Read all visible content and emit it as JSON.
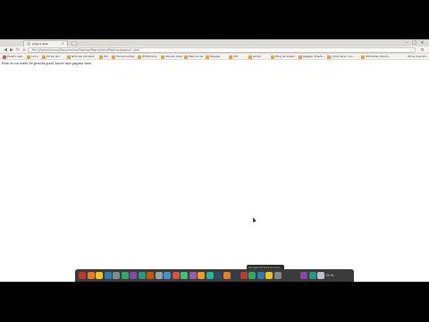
{
  "browser": {
    "tab_title": "página Web",
    "address": "file:///home/lenovo/Documentos/Paginas/Pagina/html/Paginas/pagina1.html"
  },
  "bookmarks": [
    {
      "label": "Diseño web",
      "color": "#d9534f"
    },
    {
      "label": "Linux",
      "color": "#e4a33a"
    },
    {
      "label": "Portal doc",
      "color": "#e4a33a"
    },
    {
      "label": "Noticias actuales",
      "color": "#e4a33a"
    },
    {
      "label": "W3",
      "color": "#e4a33a"
    },
    {
      "label": "Herramientas",
      "color": "#e4a33a"
    },
    {
      "label": "W3Schools",
      "color": "#e4a33a"
    },
    {
      "label": "Ubuntu Libre",
      "color": "#e4a33a"
    },
    {
      "label": "Web de sis",
      "color": "#e4a33a"
    },
    {
      "label": "Pasajes",
      "color": "#e4a33a"
    },
    {
      "label": "Pdf",
      "color": "#e4a33a"
    },
    {
      "label": "Gmail",
      "color": "#e4a33a"
    },
    {
      "label": "Blog de diseño",
      "color": "#e4a33a"
    },
    {
      "label": "Regalar diseño...",
      "color": "#e4a33a"
    },
    {
      "label": "¿Qué hacer con...",
      "color": "#e4a33a"
    },
    {
      "label": "Utilidades Ubunt...",
      "color": "#e4a33a"
    },
    {
      "label": "Otros marcad...",
      "color": "#e4a33a"
    }
  ],
  "page": {
    "text": "Este es un texto de prueba para hacer una pagina web"
  },
  "dock": {
    "tooltip": "Google Chrome (Linux)...",
    "clock": "19:01"
  },
  "colors": {
    "dock_background": "#3b3b3b",
    "dock_icons": [
      "#c0392b",
      "#e67e22",
      "#f1c40f",
      "#2980b9",
      "#7f8c8d",
      "#27ae60",
      "#8e44ad",
      "#16a085",
      "#d35400",
      "#95a5a6",
      "#3498db",
      "#e74c3c",
      "#2ecc71",
      "#9b59b6",
      "#f39c12",
      "#1abc9c",
      "#34495e",
      "#e67e22",
      "#2c3e50",
      "#c0392b",
      "#27ae60",
      "#2980b9",
      "#f1c40f",
      "#7f8c8d",
      "#8e44ad",
      "#16a085",
      "#bdc3c7"
    ]
  }
}
